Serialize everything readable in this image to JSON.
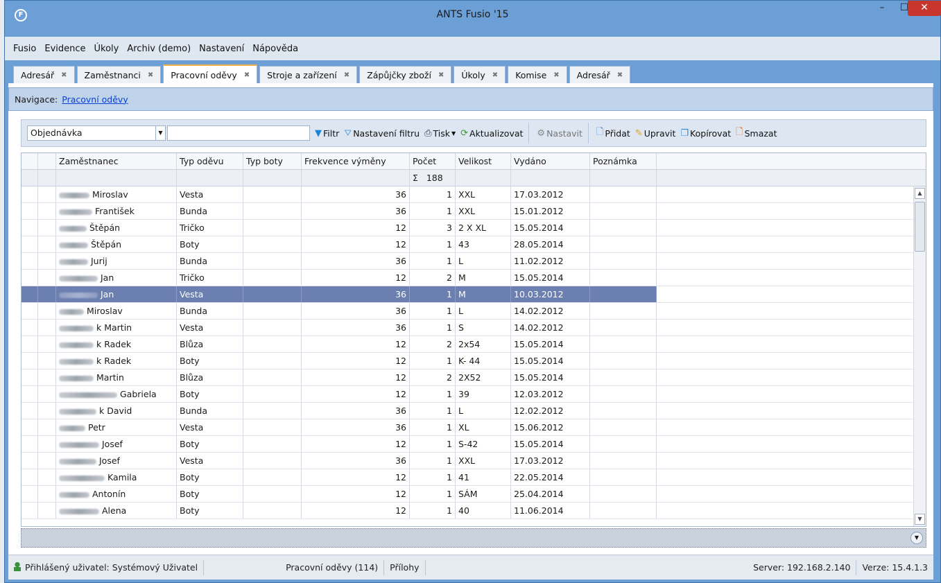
{
  "window": {
    "title": "ANTS Fusio '15",
    "icon": "F",
    "minimize": "–",
    "maximize": "☐",
    "close": "✕"
  },
  "menu": [
    "Fusio",
    "Evidence",
    "Úkoly",
    "Archiv (demo)",
    "Nastavení",
    "Nápověda"
  ],
  "tabs": [
    {
      "label": "Adresář",
      "active": false
    },
    {
      "label": "Zaměstnanci",
      "active": false
    },
    {
      "label": "Pracovní oděvy",
      "active": true
    },
    {
      "label": "Stroje a zařízení",
      "active": false
    },
    {
      "label": "Zápůjčky zboží",
      "active": false
    },
    {
      "label": "Úkoly",
      "active": false
    },
    {
      "label": "Komise",
      "active": false
    },
    {
      "label": "Adresář",
      "active": false
    }
  ],
  "tab_close_glyph": "✖",
  "navigation": {
    "label": "Navigace:",
    "link": "Pracovní oděvy"
  },
  "toolbar": {
    "combo_value": "Objednávka",
    "search_value": "",
    "filter": "Filtr",
    "filter_settings": "Nastavení filtru",
    "print": "Tisk",
    "refresh": "Aktualizovat",
    "settings": "Nastavit",
    "add": "Přidat",
    "edit": "Upravit",
    "copy": "Kopírovat",
    "delete": "Smazat"
  },
  "grid": {
    "columns": [
      "Zaměstnanec",
      "Typ oděvu",
      "Typ boty",
      "Frekvence výměny",
      "Počet",
      "Velikost",
      "Vydáno",
      "Poznámka"
    ],
    "sum_label": "Σ",
    "sum_value": "188",
    "selected_index": 6,
    "rows": [
      {
        "emp": "Miroslav",
        "typ": "Vesta",
        "boty": "",
        "frek": "36",
        "pocet": "1",
        "vel": "XXL",
        "vyd": "17.03.2012",
        "pozn": ""
      },
      {
        "emp": "František",
        "typ": "Bunda",
        "boty": "",
        "frek": "36",
        "pocet": "1",
        "vel": "XXL",
        "vyd": "15.01.2012",
        "pozn": ""
      },
      {
        "emp": "Štěpán",
        "typ": "Tričko",
        "boty": "",
        "frek": "12",
        "pocet": "3",
        "vel": "2 X XL",
        "vyd": "15.05.2014",
        "pozn": ""
      },
      {
        "emp": "Štěpán",
        "typ": "Boty",
        "boty": "",
        "frek": "12",
        "pocet": "1",
        "vel": "43",
        "vyd": "28.05.2014",
        "pozn": ""
      },
      {
        "emp": "Jurij",
        "typ": "Bunda",
        "boty": "",
        "frek": "36",
        "pocet": "1",
        "vel": "L",
        "vyd": "11.02.2012",
        "pozn": ""
      },
      {
        "emp": "Jan",
        "typ": "Tričko",
        "boty": "",
        "frek": "12",
        "pocet": "2",
        "vel": " M",
        "vyd": "15.05.2014",
        "pozn": ""
      },
      {
        "emp": "Jan",
        "typ": "Vesta",
        "boty": "",
        "frek": "36",
        "pocet": "1",
        "vel": "M",
        "vyd": "10.03.2012",
        "pozn": ""
      },
      {
        "emp": "Miroslav",
        "typ": "Bunda",
        "boty": "",
        "frek": "36",
        "pocet": "1",
        "vel": "L",
        "vyd": "14.02.2012",
        "pozn": ""
      },
      {
        "emp": "k Martin",
        "typ": "Vesta",
        "boty": "",
        "frek": "36",
        "pocet": "1",
        "vel": "S",
        "vyd": "14.02.2012",
        "pozn": ""
      },
      {
        "emp": "k Radek",
        "typ": "Blůza",
        "boty": "",
        "frek": "12",
        "pocet": "2",
        "vel": "2x54",
        "vyd": "15.05.2014",
        "pozn": ""
      },
      {
        "emp": "k Radek",
        "typ": "Boty",
        "boty": "",
        "frek": "12",
        "pocet": "1",
        "vel": "K- 44",
        "vyd": "15.05.2014",
        "pozn": ""
      },
      {
        "emp": "Martin",
        "typ": "Blůza",
        "boty": "",
        "frek": "12",
        "pocet": "2",
        "vel": "2X52",
        "vyd": "15.05.2014",
        "pozn": ""
      },
      {
        "emp": "Gabriela",
        "typ": "Boty",
        "boty": "",
        "frek": "12",
        "pocet": "1",
        "vel": "39",
        "vyd": "12.03.2012",
        "pozn": ""
      },
      {
        "emp": "k David",
        "typ": "Bunda",
        "boty": "",
        "frek": "36",
        "pocet": "1",
        "vel": "L",
        "vyd": "12.02.2012",
        "pozn": ""
      },
      {
        "emp": "Petr",
        "typ": "Vesta",
        "boty": "",
        "frek": "36",
        "pocet": "1",
        "vel": "XL",
        "vyd": "15.06.2012",
        "pozn": ""
      },
      {
        "emp": "Josef",
        "typ": "Boty",
        "boty": "",
        "frek": "12",
        "pocet": "1",
        "vel": "S-42",
        "vyd": "15.05.2014",
        "pozn": ""
      },
      {
        "emp": "Josef",
        "typ": "Vesta",
        "boty": "",
        "frek": "36",
        "pocet": "1",
        "vel": "XXL",
        "vyd": "17.03.2012",
        "pozn": ""
      },
      {
        "emp": "Kamila",
        "typ": "Boty",
        "boty": "",
        "frek": "12",
        "pocet": "1",
        "vel": "41",
        "vyd": "22.05.2014",
        "pozn": ""
      },
      {
        "emp": "Antonín",
        "typ": "Boty",
        "boty": "",
        "frek": "12",
        "pocet": "1",
        "vel": "SÁM",
        "vyd": "25.04.2014",
        "pozn": ""
      },
      {
        "emp": "Alena",
        "typ": "Boty",
        "boty": "",
        "frek": "12",
        "pocet": "1",
        "vel": "40",
        "vyd": "11.06.2014",
        "pozn": ""
      }
    ]
  },
  "statusbar": {
    "user": "Přihlášený uživatel: Systémový Uživatel",
    "module": "Pracovní oděvy (114)",
    "attachments": "Přílohy",
    "server": "Server: 192.168.2.140",
    "version": "Verze: 15.4.1.3"
  },
  "colors": {
    "frame": "#6c9fd6",
    "selected_row": "#6b7fb1",
    "close_button": "#c7352d",
    "active_tab_accent": "#f0b240"
  }
}
